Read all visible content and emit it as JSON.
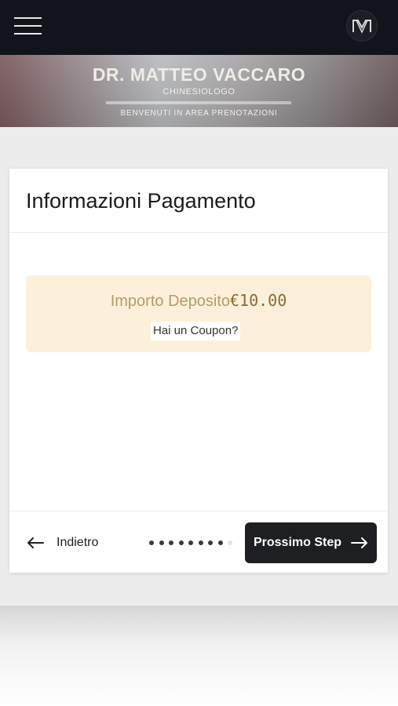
{
  "topbar": {
    "menu_icon": "hamburger-menu-icon",
    "logo_icon": "mv-monogram-logo",
    "logo_text": "M"
  },
  "banner": {
    "title": "DR. MATTEO VACCARO",
    "subtitle": "CHINESIOLOGO",
    "welcome": "BENVENUTI IN AREA PRENOTAZIONI"
  },
  "card": {
    "title": "Informazioni Pagamento",
    "deposit_label": "Importo Deposito",
    "deposit_amount": "€10.00",
    "coupon_link": "Hai un Coupon?"
  },
  "footer": {
    "back_label": "Indietro",
    "back_icon": "arrow-left-icon",
    "next_label": "Prossimo Step",
    "next_icon": "arrow-right-icon",
    "steps_total": 9,
    "current_step": 8
  },
  "colors": {
    "topbar": "#12141c",
    "deposit_bg": "#fdf0da",
    "button_dark": "#1e1f22"
  }
}
